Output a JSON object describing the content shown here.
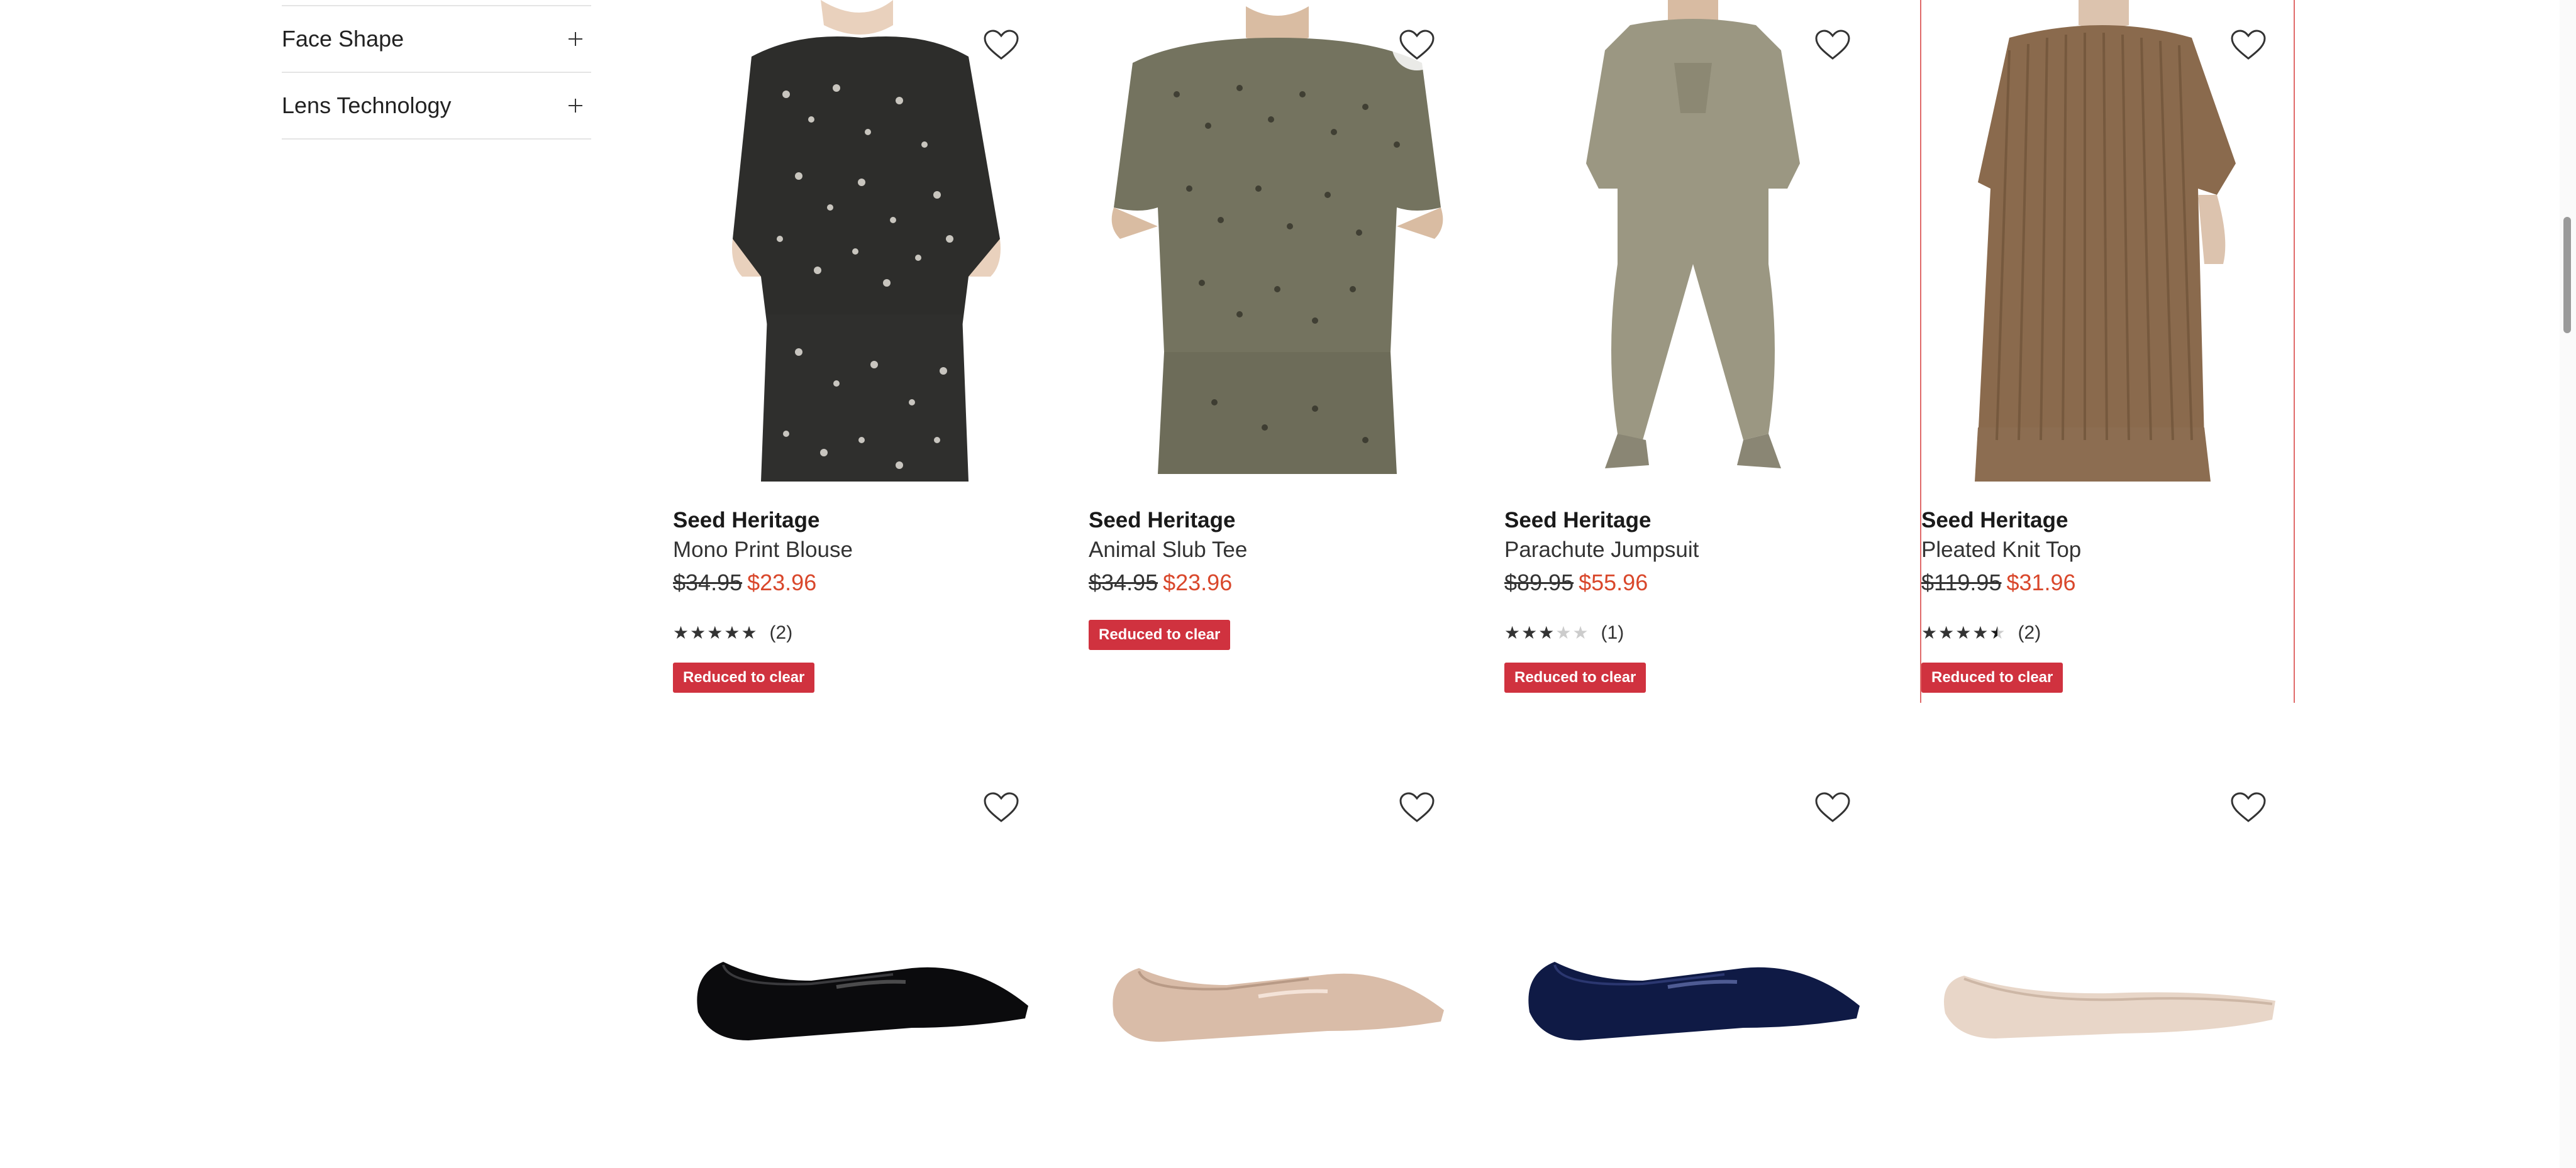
{
  "filters": [
    {
      "label": "Face Shape"
    },
    {
      "label": "Lens Technology"
    }
  ],
  "products": [
    {
      "brand": "Seed Heritage",
      "name": "Mono Print Blouse",
      "was": "$34.95",
      "now": "$23.96",
      "stars": 5,
      "reviews": "(2)",
      "badge": "Reduced to clear",
      "image": "model-mono-print-blouse"
    },
    {
      "brand": "Seed Heritage",
      "name": "Animal Slub Tee",
      "was": "$34.95",
      "now": "$23.96",
      "badge": "Reduced to clear",
      "image": "model-animal-slub-tee"
    },
    {
      "brand": "Seed Heritage",
      "name": "Parachute Jumpsuit",
      "was": "$89.95",
      "now": "$55.96",
      "stars": 3,
      "reviews": "(1)",
      "badge": "Reduced to clear",
      "image": "model-parachute-jumpsuit"
    },
    {
      "brand": "Seed Heritage",
      "name": "Pleated Knit Top",
      "was": "$119.95",
      "now": "$31.96",
      "stars": 4.5,
      "reviews": "(2)",
      "badge": "Reduced to clear",
      "image": "model-pleated-knit-top"
    }
  ],
  "shoes": [
    {
      "image": "black-patent-flat",
      "color": "#0b0b0d"
    },
    {
      "image": "nude-patent-flat",
      "color": "#d9bca8"
    },
    {
      "image": "navy-patent-flat",
      "color": "#0f1a45"
    },
    {
      "image": "cream-leather-flat",
      "color": "#e8d6c8"
    }
  ],
  "colors": {
    "sale_price": "#d9472b",
    "badge": "#d0323f",
    "highlight_border": "#e06a6a"
  },
  "icons": {
    "wishlist": "heart-outline-icon",
    "expand": "plus-icon"
  }
}
